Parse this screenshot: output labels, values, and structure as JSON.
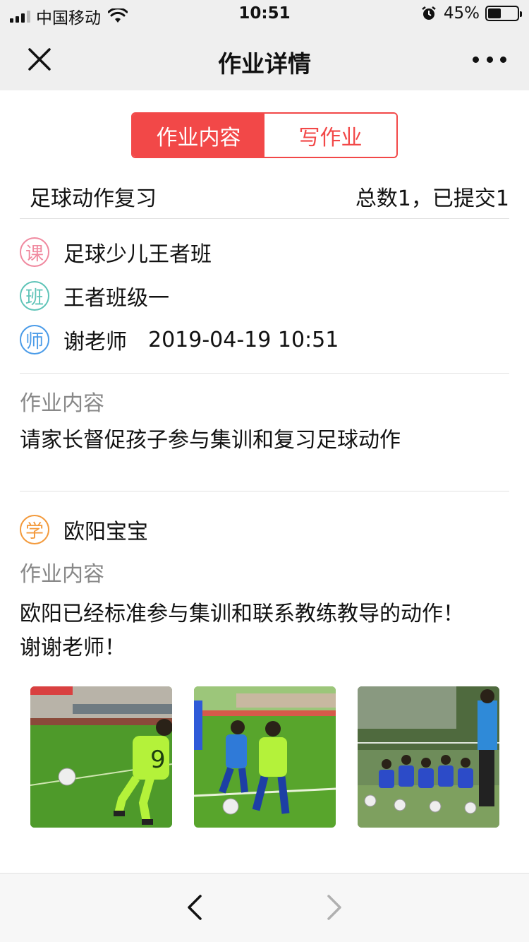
{
  "status_bar": {
    "carrier": "中国移动",
    "time": "10:51",
    "battery": "45%"
  },
  "nav": {
    "title": "作业详情"
  },
  "tabs": [
    {
      "label": "作业内容",
      "active": true
    },
    {
      "label": "写作业",
      "active": false
    }
  ],
  "homework": {
    "title": "足球动作复习",
    "count_text": "总数1，已提交1"
  },
  "info": {
    "course_badge": "课",
    "course": "足球少儿王者班",
    "class_badge": "班",
    "class_name": "王者班级一",
    "teacher_badge": "师",
    "teacher": "谢老师",
    "datetime": "2019-04-19 10:51"
  },
  "content": {
    "label": "作业内容",
    "text": "请家长督促孩子参与集训和复习足球动作"
  },
  "submission": {
    "badge": "学",
    "student": "欧阳宝宝",
    "label": "作业内容",
    "line1": "欧阳已经标准参与集训和联系教练教导的动作！",
    "line2": "谢谢老师！",
    "photos": [
      "football-kick-photo",
      "football-dribble-photo",
      "team-training-photo"
    ]
  },
  "colors": {
    "accent": "#f24848",
    "course_badge": "#f08aa0",
    "class_badge": "#5fc4b8",
    "teacher_badge": "#4a9be8",
    "student_badge": "#f39a3c"
  }
}
